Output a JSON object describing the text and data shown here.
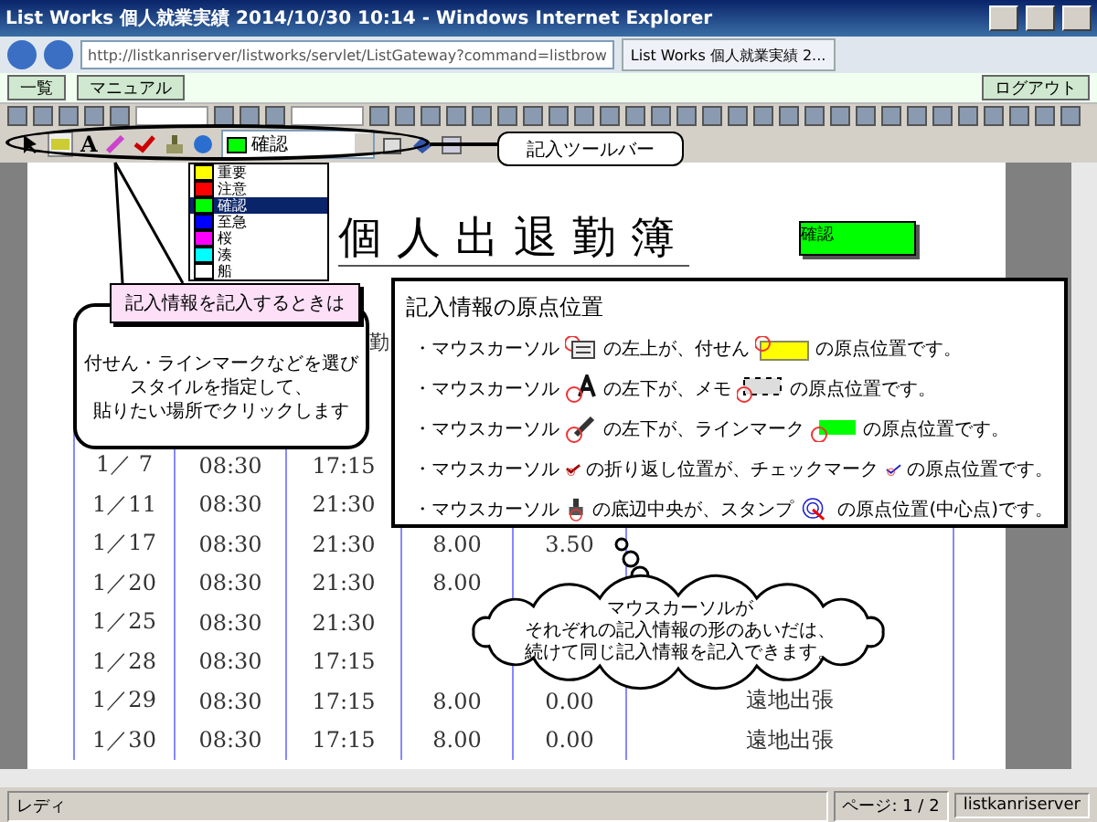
{
  "window": {
    "title": "List Works 個人就業実績 2014/10/30 10:14 - Windows Internet Explorer"
  },
  "address_bar": {
    "url": "http://listkanriserver/listworks/servlet/ListGateway?command=listbrow"
  },
  "browser_tab": {
    "title": "List Works 個人就業実績 2..."
  },
  "app_bar": {
    "buttons": [
      {
        "label": "一覧"
      },
      {
        "label": "マニュアル"
      }
    ],
    "logout": "ログアウト"
  },
  "annotation_toolbar": {
    "text_tool": "A",
    "style": {
      "label": "確認",
      "color": "#00ff00"
    },
    "options": [
      {
        "label": "重要",
        "color": "#ffff00",
        "selected": false
      },
      {
        "label": "注意",
        "color": "#ff0000",
        "selected": false
      },
      {
        "label": "確認",
        "color": "#00ff00",
        "selected": true
      },
      {
        "label": "至急",
        "color": "#0000ff",
        "selected": false
      },
      {
        "label": "桜",
        "color": "#ff00ff",
        "selected": false
      },
      {
        "label": "湊",
        "color": "#00ffff",
        "selected": false
      },
      {
        "label": "船",
        "color": "#ffffff",
        "selected": false
      }
    ]
  },
  "document": {
    "title": "個人出退勤簿",
    "stamp": {
      "label": "確認",
      "color": "#00ff00"
    },
    "header": {
      "column_3": "勤"
    },
    "rows": [
      {
        "date": "1／ 7",
        "in": "08:30",
        "out": "17:15"
      },
      {
        "date": "1／11",
        "in": "08:30",
        "out": "21:30"
      },
      {
        "date": "1／17",
        "in": "08:30",
        "out": "21:30",
        "hours": "8.00",
        "overtime": "3.50"
      },
      {
        "date": "1／20",
        "in": "08:30",
        "out": "21:30",
        "hours": "8.00"
      },
      {
        "date": "1／25",
        "in": "08:30",
        "out": "21:30"
      },
      {
        "date": "1／28",
        "in": "08:30",
        "out": "17:15"
      },
      {
        "date": "1／29",
        "in": "08:30",
        "out": "17:15",
        "hours": "8.00",
        "overtime": "0.00",
        "note": "遠地出張"
      },
      {
        "date": "1／30",
        "in": "08:30",
        "out": "17:15",
        "hours": "8.00",
        "overtime": "0.00",
        "note": "遠地出張"
      }
    ]
  },
  "callouts": {
    "toolbar_label": "記入ツールバー",
    "howto_title": "記入情報を記入するときは",
    "howto_lines": [
      "付せん・ラインマークなどを選び",
      "スタイルを指定して、",
      "貼りたい場所でクリックします"
    ],
    "origin_title": "記入情報の原点位置",
    "origin_rows": [
      {
        "kind": "sticky",
        "lead": "・マウスカーソル",
        "middle": "の左上が、付せん",
        "tail": "の原点位置です。"
      },
      {
        "kind": "memo",
        "lead": "・マウスカーソル",
        "middle": "の左下が、メモ",
        "tail": "の原点位置です。"
      },
      {
        "kind": "line",
        "lead": "・マウスカーソル",
        "middle": "の左下が、ラインマーク",
        "tail": "の原点位置です。"
      },
      {
        "kind": "check",
        "lead": "・マウスカーソル",
        "middle": "の折り返し位置が、チェックマーク",
        "tail": "の原点位置です。"
      },
      {
        "kind": "stamp",
        "lead": "・マウスカーソル",
        "middle": "の底辺中央が、スタンプ",
        "tail": "の原点位置(中心点)です。"
      }
    ],
    "cloud_lines": [
      "マウスカーソルが",
      "それぞれの記入情報の形のあいだは、",
      "続けて同じ記入情報を記入できます。"
    ]
  },
  "status_bar": {
    "status": "レディ",
    "page": "ページ: 1 / 2",
    "server": "listkanriserver"
  }
}
